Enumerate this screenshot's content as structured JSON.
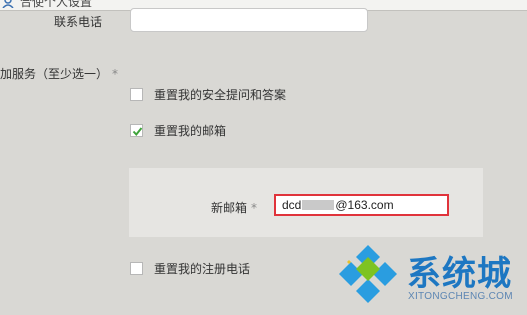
{
  "window": {
    "title": "合使个人设置",
    "icon": "user-icon"
  },
  "form": {
    "phone_label": "联系电话",
    "phone_value": "",
    "services_label": "加服务（至少选一）",
    "services_required_mark": "*",
    "options": [
      {
        "label": "重置我的安全提问和答案",
        "checked": false
      },
      {
        "label": "重置我的邮箱",
        "checked": true
      },
      {
        "label": "重置我的注册电话",
        "checked": false
      }
    ],
    "new_email": {
      "label": "新邮箱",
      "required_mark": "*",
      "value_prefix": "dcd",
      "value_suffix": "@163.com",
      "highlight_color": "#e0333b"
    }
  },
  "watermark": {
    "brand": "系统城",
    "domain": "XITONGCHENG.COM",
    "color": "#1d77c2"
  }
}
